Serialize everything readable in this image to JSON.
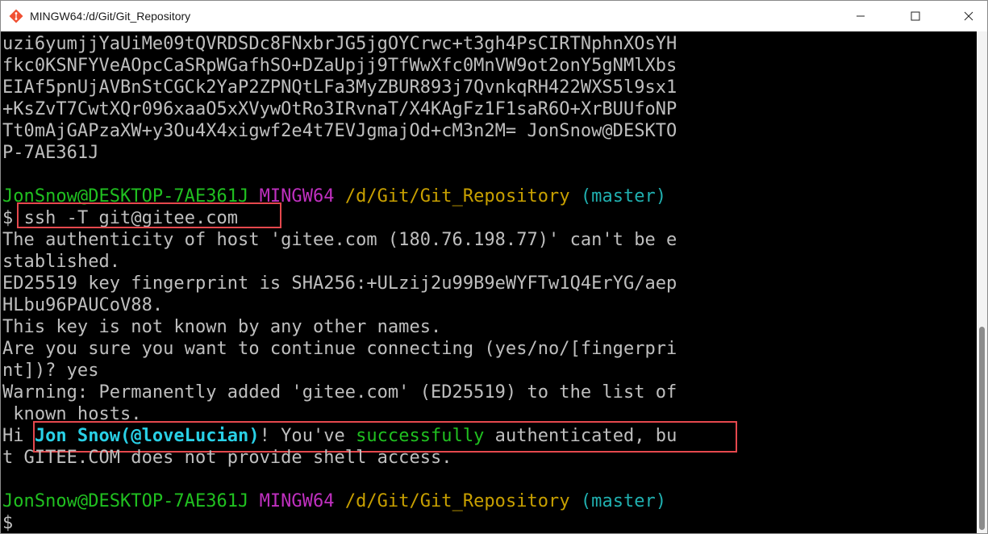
{
  "window": {
    "title": "MINGW64:/d/Git/Git_Repository",
    "controls": [
      "minimize",
      "maximize",
      "close"
    ]
  },
  "terminal": {
    "key_lines": [
      "uzi6yumjjYaUiMe09tQVRDSDc8FNxbrJG5jgOYCrwc+t3gh4PsCIRTNphnXOsYH",
      "fkc0KSNFYVeAOpcCaSRpWGafhSO+DZaUpjj9TfWwXfc0MnVW9ot2onY5gNMlXbs",
      "EIAf5pnUjAVBnStCGCk2YaP2ZPNQtLFa3MyZBUR893j7QvnkqRH422WXS5l9sx1",
      "+KsZvT7CwtXQr096xaaO5xXVywOtRo3IRvnaT/X4KAgFz1F1saR6O+XrBUUfoNP",
      "Tt0mAjGAPzaXW+y3Ou4X4xigwf2e4t7EVJgmajOd+cM3n2M= JonSnow@DESKTO",
      "P-7AE361J"
    ],
    "prompt1": {
      "user": "JonSnow@DESKTOP-7AE361J",
      "shell": "MINGW64",
      "path": "/d/Git/Git_Repository",
      "branch": "(master)"
    },
    "command": {
      "prefix": "$",
      "text": "ssh -T git@gitee.com"
    },
    "output_lines": [
      "The authenticity of host 'gitee.com (180.76.198.77)' can't be e",
      "stablished.",
      "ED25519 key fingerprint is SHA256:+ULzij2u99B9eWYFTw1Q4ErYG/aep",
      "HLbu96PAUCoV88.",
      "This key is not known by any other names.",
      "Are you sure you want to continue connecting (yes/no/[fingerpri",
      "nt])? yes",
      "Warning: Permanently added 'gitee.com' (ED25519) to the list of",
      " known hosts."
    ],
    "auth_line": {
      "hi": "Hi ",
      "name": "Jon Snow(@loveLucian)",
      "bang": "! You've ",
      "success": "successfully",
      "rest": " authenticated, bu"
    },
    "auth_line2": "t GITEE.COM does not provide shell access.",
    "prompt2": {
      "user": "JonSnow@DESKTOP-7AE361J",
      "shell": "MINGW64",
      "path": "/d/Git/Git_Repository",
      "branch": "(master)"
    },
    "final_prompt": "$"
  },
  "colors": {
    "green": "#20c020",
    "magenta": "#c030c0",
    "yellow": "#c8a000",
    "cyan": "#20b0b0",
    "text": "#bfbfbf",
    "highlight": "#e5484d"
  }
}
